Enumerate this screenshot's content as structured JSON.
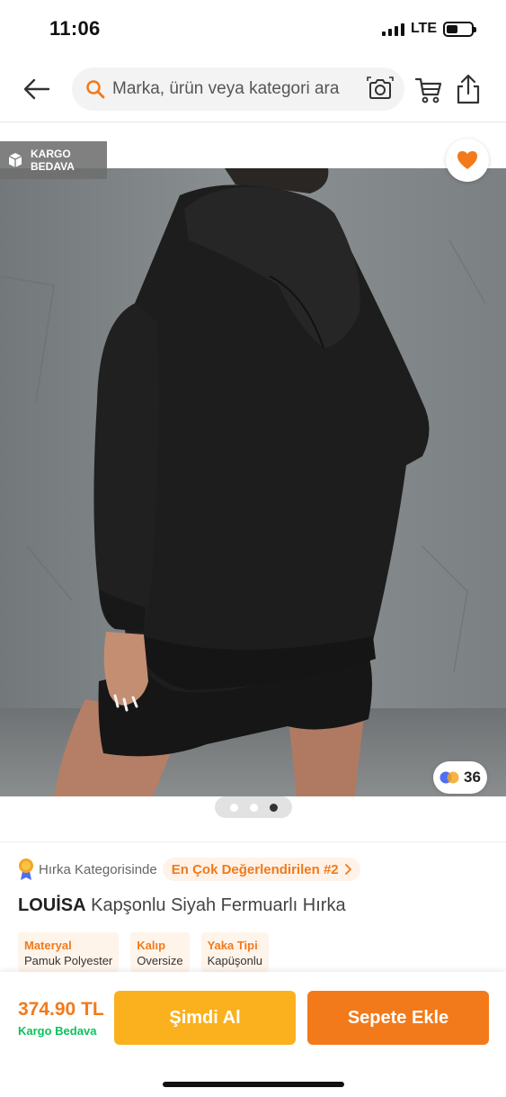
{
  "status_bar": {
    "time": "11:06",
    "network": "LTE",
    "battery_level": 0.45
  },
  "header": {
    "search_placeholder": "Marka, ürün veya kategori ara",
    "icons": [
      "back-arrow-icon",
      "search-icon",
      "camera-icon",
      "cart-icon",
      "share-icon"
    ]
  },
  "gallery": {
    "cargo_badge": "KARGO BEDAVA",
    "review_count": "36",
    "image_count": 3,
    "active_image": 3,
    "favorite_color": "#f27a1a"
  },
  "rank": {
    "category_text": "Hırka Kategorisinde",
    "rank_text": "En Çok Değerlendirilen #2"
  },
  "product": {
    "brand": "LOUİSA",
    "name": "Kapşonlu Siyah Fermuarlı Hırka",
    "attributes": [
      {
        "key": "Materyal",
        "value": "Pamuk Polyester"
      },
      {
        "key": "Kalıp",
        "value": "Oversize"
      },
      {
        "key": "Yaka Tipi",
        "value": "Kapüşonlu"
      }
    ]
  },
  "bottom_bar": {
    "price": "374.90 TL",
    "shipping": "Kargo Bedava",
    "buy_now": "Şimdi Al",
    "add_to_cart": "Sepete Ekle"
  },
  "colors": {
    "accent": "#f27a1a",
    "buy_now": "#fbb11d",
    "free_shipping": "#0bc15c"
  }
}
